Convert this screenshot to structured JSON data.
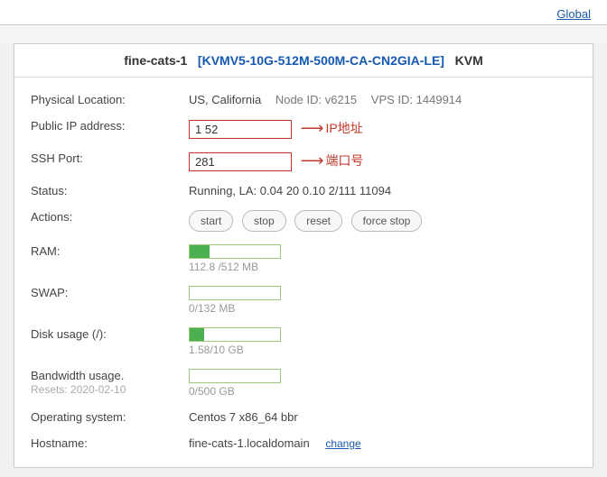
{
  "top_link": "Global",
  "header": {
    "name": "fine-cats-1",
    "plan": "[KVMV5-10G-512M-500M-CA-CN2GIA-LE]",
    "type": "KVM"
  },
  "labels": {
    "location": "Physical Location:",
    "ip": "Public IP address:",
    "ssh": "SSH Port:",
    "status": "Status:",
    "actions": "Actions:",
    "ram": "RAM:",
    "swap": "SWAP:",
    "disk": "Disk usage (/):",
    "bw": "Bandwidth usage.",
    "bw_sub": "Resets: 2020-02-10",
    "os": "Operating system:",
    "hostname": "Hostname:"
  },
  "location": {
    "place": "US, California",
    "node": "Node ID: v6215",
    "vps": "VPS ID: 1449914"
  },
  "ip": {
    "value": "1              52",
    "annotation": "IP地址"
  },
  "ssh": {
    "value": "281",
    "annotation": "端口号"
  },
  "status": "Running, LA: 0.04   20 0.10 2/111 11094",
  "actions": {
    "start": "start",
    "stop": "stop",
    "reset": "reset",
    "force": "force stop"
  },
  "ram": {
    "pct": 22,
    "text": "112.8 /512 MB"
  },
  "swap": {
    "pct": 0,
    "text": "0/132 MB"
  },
  "disk": {
    "pct": 16,
    "text": "1.58/10 GB"
  },
  "bw": {
    "pct": 0,
    "text": "0/500 GB"
  },
  "os": "Centos 7 x86_64 bbr",
  "hostname": {
    "value": "fine-cats-1.localdomain",
    "change": "change"
  }
}
